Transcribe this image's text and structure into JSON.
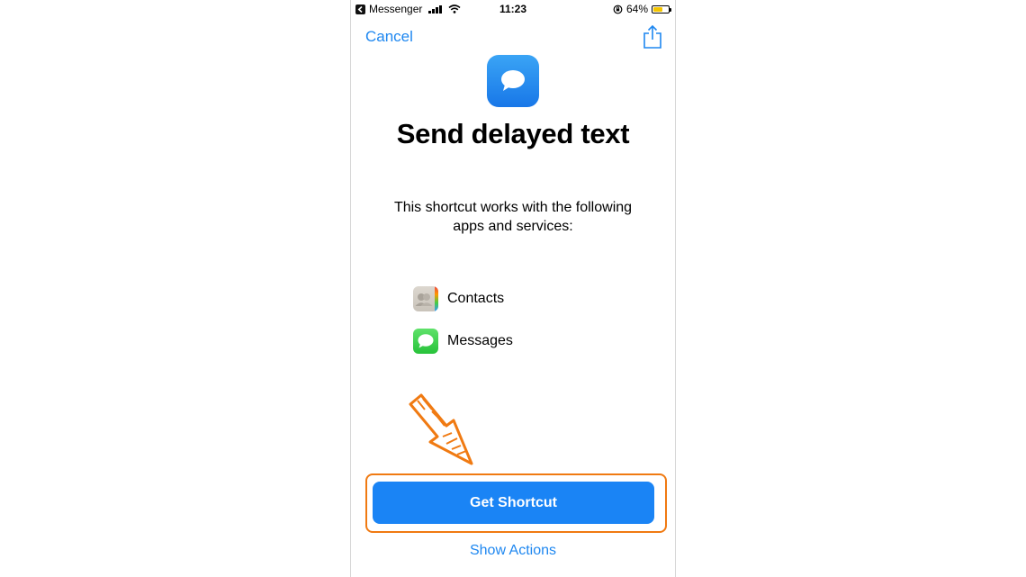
{
  "status_bar": {
    "back_app": "Messenger",
    "time": "11:23",
    "battery": "64%",
    "battery_level": 0.64
  },
  "nav": {
    "cancel_label": "Cancel"
  },
  "shortcut": {
    "title": "Send delayed text",
    "description": "This shortcut works with the following apps and services:"
  },
  "services": [
    {
      "label": "Contacts",
      "icon": "contacts-icon"
    },
    {
      "label": "Messages",
      "icon": "messages-icon"
    }
  ],
  "buttons": {
    "get_shortcut": "Get Shortcut",
    "show_actions": "Show Actions"
  },
  "colors": {
    "accent": "#1e87f0",
    "button": "#1a84f5",
    "annotation": "#f07a12",
    "battery": "#f4c500"
  }
}
